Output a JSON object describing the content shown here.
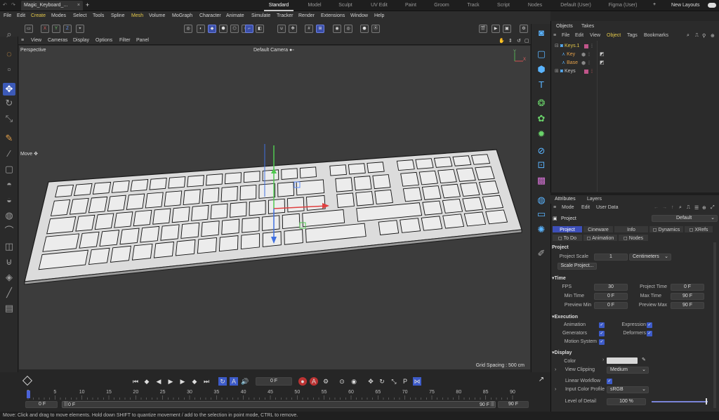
{
  "app": {
    "doc_tab": "Magic_Keyboard_...",
    "layouts": [
      "Standard",
      "Model",
      "Sculpt",
      "UV Edit",
      "Paint",
      "Groom",
      "Track",
      "Script",
      "Nodes",
      "Default (User)",
      "Figma (User)"
    ],
    "new_layouts": "New Layouts"
  },
  "menu": [
    "File",
    "Edit",
    "Create",
    "Modes",
    "Select",
    "Tools",
    "Spline",
    "Mesh",
    "Volume",
    "MoGraph",
    "Character",
    "Animate",
    "Simulate",
    "Tracker",
    "Render",
    "Extensions",
    "Window",
    "Help"
  ],
  "axis_buttons": [
    "X",
    "Y",
    "Z"
  ],
  "viewport": {
    "menu": [
      "View",
      "Cameras",
      "Display",
      "Options",
      "Filter",
      "Panel"
    ],
    "label": "Perspective",
    "camera": "Default Camera",
    "camera_icon": "●◦",
    "tool_hint": "Move",
    "grid_spacing": "Grid Spacing : 500 cm"
  },
  "timeline": {
    "current_frame": "0 F",
    "ruler": [
      "0",
      "5",
      "10",
      "15",
      "20",
      "25",
      "30",
      "35",
      "40",
      "45",
      "50",
      "55",
      "60",
      "65",
      "70",
      "75",
      "80",
      "85",
      "90"
    ],
    "start": "0 F",
    "range_start": "0 F",
    "range_end": "90 F",
    "end": "90 F",
    "handle": "|||"
  },
  "status": "Move: Click and drag to move elements. Hold down SHIFT to quantize movement / add to the selection in point mode, CTRL to remove.",
  "objects_panel": {
    "tabs": [
      "Objects",
      "Takes"
    ],
    "menu": [
      "File",
      "Edit",
      "View",
      "Object",
      "Tags",
      "Bookmarks"
    ],
    "tree": [
      {
        "name": "Keys.1",
        "color": "#e3c84a"
      },
      {
        "name": "Key",
        "color": "#e3a04a"
      },
      {
        "name": "Base",
        "color": "#e3a04a"
      },
      {
        "name": "Keys",
        "color": "#d0d0d0"
      }
    ]
  },
  "attributes": {
    "tabs": [
      "Attributes",
      "Layers"
    ],
    "menu": [
      "Mode",
      "Edit",
      "User Data"
    ],
    "object": "Project",
    "preset": "Default",
    "row1": [
      "Project",
      "Cineware",
      "Info",
      "Dynamics",
      "XRefs"
    ],
    "row2": [
      "To Do",
      "Animation",
      "Nodes"
    ],
    "section": "Project",
    "project_scale_label": "Project Scale",
    "project_scale": "1",
    "units": "Centimeters",
    "scale_button": "Scale Project...",
    "time_header": "Time",
    "fps_label": "FPS",
    "fps": "30",
    "project_time_label": "Project Time",
    "project_time": "0 F",
    "min_time_label": "Min Time",
    "min_time": "0 F",
    "max_time_label": "Max Time",
    "max_time": "90 F",
    "preview_min_label": "Preview Min",
    "preview_min": "0 F",
    "preview_max_label": "Preview Max",
    "preview_max": "90 F",
    "exec_header": "Execution",
    "animation_label": "Animation",
    "expression_label": "Expression",
    "generators_label": "Generators",
    "deformers_label": "Deformers",
    "motion_label": "Motion System",
    "display_header": "Display",
    "color_label": "Color",
    "view_clipping_label": "View Clipping",
    "view_clipping": "Medium",
    "linear_workflow_label": "Linear Workflow",
    "input_color_label": "Input Color Profile",
    "input_color": "sRGB",
    "lod_label": "Level of Detail",
    "lod": "100 %"
  },
  "colors": {
    "accent": "#3d5bc9",
    "viewport_bg": "#3c3c3c",
    "key": "#e6e6e6",
    "selection": "#e3c84a"
  }
}
